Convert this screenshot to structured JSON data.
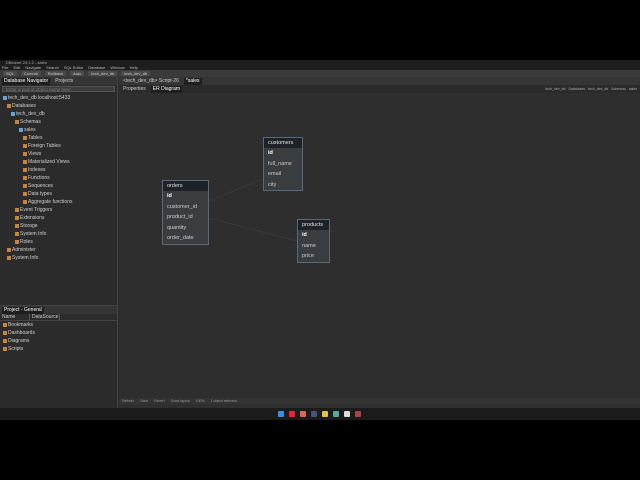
{
  "window": {
    "title": "DBeaver 24.1.2 - sales",
    "menu": [
      "File",
      "Edit",
      "Navigate",
      "Search",
      "SQL Editor",
      "Database",
      "Window",
      "Help"
    ],
    "toolbar": {
      "sql": "SQL",
      "commit": "Commit",
      "rollback": "Rollback",
      "mode": "Auto",
      "ds1": "tech_dev_db",
      "ds2": "tech_dev_db"
    }
  },
  "navigator": {
    "tabs": [
      "Database Navigator",
      "Projects"
    ],
    "filter_placeholder": "Enter a part of object name here",
    "tree": [
      {
        "label": "tech_dev_db  localhost:5433",
        "level": 0,
        "icon": "db"
      },
      {
        "label": "Databases",
        "level": 1,
        "icon": "folder"
      },
      {
        "label": "tech_dev_db",
        "level": 2,
        "icon": "db"
      },
      {
        "label": "Schemas",
        "level": 3,
        "icon": "folder"
      },
      {
        "label": "sales",
        "level": 4,
        "icon": "db"
      },
      {
        "label": "Tables",
        "level": 5,
        "icon": "folder"
      },
      {
        "label": "Foreign Tables",
        "level": 5,
        "icon": "folder"
      },
      {
        "label": "Views",
        "level": 5,
        "icon": "folder"
      },
      {
        "label": "Materialized Views",
        "level": 5,
        "icon": "folder"
      },
      {
        "label": "Indexes",
        "level": 5,
        "icon": "folder"
      },
      {
        "label": "Functions",
        "level": 5,
        "icon": "folder"
      },
      {
        "label": "Sequences",
        "level": 5,
        "icon": "folder"
      },
      {
        "label": "Data types",
        "level": 5,
        "icon": "folder"
      },
      {
        "label": "Aggregate functions",
        "level": 5,
        "icon": "folder"
      },
      {
        "label": "Event Triggers",
        "level": 3,
        "icon": "folder"
      },
      {
        "label": "Extensions",
        "level": 3,
        "icon": "folder"
      },
      {
        "label": "Storage",
        "level": 3,
        "icon": "folder"
      },
      {
        "label": "System Info",
        "level": 3,
        "icon": "folder"
      },
      {
        "label": "Roles",
        "level": 3,
        "icon": "folder"
      },
      {
        "label": "Administer",
        "level": 1,
        "icon": "folder"
      },
      {
        "label": "System Info",
        "level": 1,
        "icon": "folder"
      }
    ]
  },
  "project": {
    "tab": "Project - General",
    "columns": [
      "Name",
      "DataSource"
    ],
    "items": [
      "Bookmarks",
      "Dashboards",
      "Diagrams",
      "Scripts"
    ]
  },
  "editor": {
    "tabs": [
      "<tech_dev_db> Script-26",
      "*sales"
    ],
    "subtabs": [
      "Properties",
      "ER Diagram"
    ],
    "breadcrumb": [
      "tech_dev_db",
      "Databases",
      "tech_dev_db",
      "Schemas",
      "sales"
    ],
    "statusbar": [
      "Refresh",
      "Save",
      "Revert",
      "Show layout",
      "100%",
      "1 object selected"
    ]
  },
  "entities": [
    {
      "name": "customers",
      "columns": [
        "id",
        "full_name",
        "email",
        "city"
      ]
    },
    {
      "name": "orders",
      "columns": [
        "id",
        "customer_id",
        "product_id",
        "quantity",
        "order_date"
      ]
    },
    {
      "name": "products",
      "columns": [
        "id",
        "name",
        "price"
      ]
    }
  ]
}
